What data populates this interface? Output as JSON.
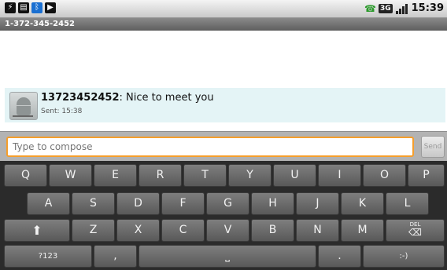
{
  "status_bar": {
    "time": "15:39",
    "icons": [
      "usb-icon",
      "sd-card-icon",
      "bluetooth-icon",
      "media-play-icon",
      "call-icon",
      "3g-icon",
      "signal-icon"
    ],
    "network_label": "3G"
  },
  "title": "1-372-345-2452",
  "message": {
    "sender": "13723452452",
    "text": ": Nice to meet you",
    "sent": "Sent: 15:38"
  },
  "compose": {
    "placeholder": "Type to compose",
    "send_label": "Send"
  },
  "keyboard": {
    "row1": [
      "Q",
      "W",
      "E",
      "R",
      "T",
      "Y",
      "U",
      "I",
      "O",
      "P"
    ],
    "row2": [
      "A",
      "S",
      "D",
      "F",
      "G",
      "H",
      "J",
      "K",
      "L"
    ],
    "row3": [
      "Z",
      "X",
      "C",
      "V",
      "B",
      "N",
      "M"
    ],
    "shift_icon": "shift-icon",
    "delete_label": "DEL",
    "symbols_label": "?123",
    "comma_label": ",",
    "period_label": ".",
    "smiley_label": ":-)",
    "space_icon": "space-icon"
  },
  "colors": {
    "compose_border": "#f59e2b",
    "message_bg": "#e4f4f6",
    "keyboard_bg": "#2b2b2b"
  }
}
